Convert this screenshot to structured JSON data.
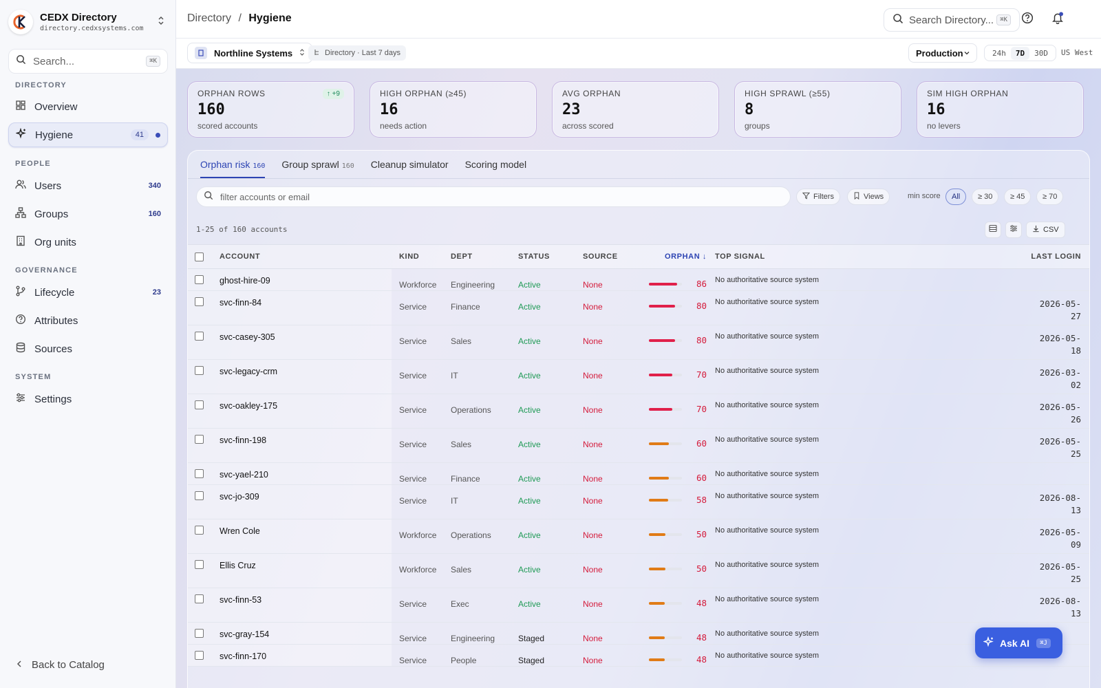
{
  "brand": {
    "name": "CEDX Directory",
    "url": "directory.cedxsystems.com"
  },
  "sidebar": {
    "search_placeholder": "Search...",
    "search_kbd": "⌘K",
    "sections": {
      "directory": "DIRECTORY",
      "people": "PEOPLE",
      "governance": "GOVERNANCE",
      "system": "SYSTEM"
    },
    "items": {
      "overview": {
        "label": "Overview"
      },
      "hygiene": {
        "label": "Hygiene",
        "count": "41"
      },
      "users": {
        "label": "Users",
        "count": "340"
      },
      "groups": {
        "label": "Groups",
        "count": "160"
      },
      "orgunits": {
        "label": "Org units"
      },
      "lifecycle": {
        "label": "Lifecycle",
        "count": "23"
      },
      "attributes": {
        "label": "Attributes"
      },
      "sources": {
        "label": "Sources"
      },
      "settings": {
        "label": "Settings"
      }
    },
    "back": "Back to Catalog"
  },
  "header": {
    "crumb_parent": "Directory",
    "crumb_sep": "/",
    "crumb_current": "Hygiene",
    "search_placeholder": "Search Directory...",
    "search_kbd": "⌘K"
  },
  "subbar": {
    "org": "Northline Systems",
    "scope": "Directory · Last 7 days",
    "env": "Production",
    "ranges": [
      "24h",
      "7D",
      "30D"
    ],
    "region": "US West"
  },
  "kpis": [
    {
      "label": "ORPHAN ROWS",
      "value": "160",
      "sub": "scored accounts",
      "delta": "↑ +9"
    },
    {
      "label": "HIGH ORPHAN (≥45)",
      "value": "16",
      "sub": "needs action"
    },
    {
      "label": "AVG ORPHAN",
      "value": "23",
      "sub": "across scored"
    },
    {
      "label": "HIGH SPRAWL (≥55)",
      "value": "8",
      "sub": "groups"
    },
    {
      "label": "SIM HIGH ORPHAN",
      "value": "16",
      "sub": "no levers"
    }
  ],
  "tabs": [
    {
      "label": "Orphan risk",
      "count": "160"
    },
    {
      "label": "Group sprawl",
      "count": "160"
    },
    {
      "label": "Cleanup simulator"
    },
    {
      "label": "Scoring model"
    }
  ],
  "filter": {
    "placeholder": "filter accounts or email",
    "filters": "Filters",
    "views": "Views",
    "min_score": "min score",
    "scores": [
      "All",
      "≥ 30",
      "≥ 45",
      "≥ 70"
    ]
  },
  "list": {
    "count": "1-25 of 160 accounts",
    "csv": "CSV"
  },
  "columns": {
    "account": "ACCOUNT",
    "kind": "KIND",
    "dept": "DEPT",
    "status": "STATUS",
    "source": "SOURCE",
    "orphan": "ORPHAN ↓",
    "signal": "TOP SIGNAL",
    "login": "LAST LOGIN"
  },
  "rows": [
    {
      "account": "ghost-hire-09",
      "kind": "Workforce",
      "dept": "Engineering",
      "status": "Active",
      "source": "None",
      "score": 86,
      "signal": "No authoritative source system",
      "login": ""
    },
    {
      "account": "svc-finn-84",
      "kind": "Service",
      "dept": "Finance",
      "status": "Active",
      "source": "None",
      "score": 80,
      "signal": "No authoritative source system",
      "login": "2026-05-27"
    },
    {
      "account": "svc-casey-305",
      "kind": "Service",
      "dept": "Sales",
      "status": "Active",
      "source": "None",
      "score": 80,
      "signal": "No authoritative source system",
      "login": "2026-05-18"
    },
    {
      "account": "svc-legacy-crm",
      "kind": "Service",
      "dept": "IT",
      "status": "Active",
      "source": "None",
      "score": 70,
      "signal": "No authoritative source system",
      "login": "2026-03-02"
    },
    {
      "account": "svc-oakley-175",
      "kind": "Service",
      "dept": "Operations",
      "status": "Active",
      "source": "None",
      "score": 70,
      "signal": "No authoritative source system",
      "login": "2026-05-26"
    },
    {
      "account": "svc-finn-198",
      "kind": "Service",
      "dept": "Sales",
      "status": "Active",
      "source": "None",
      "score": 60,
      "signal": "No authoritative source system",
      "login": "2026-05-25"
    },
    {
      "account": "svc-yael-210",
      "kind": "Service",
      "dept": "Finance",
      "status": "Active",
      "source": "None",
      "score": 60,
      "signal": "No authoritative source system",
      "login": ""
    },
    {
      "account": "svc-jo-309",
      "kind": "Service",
      "dept": "IT",
      "status": "Active",
      "source": "None",
      "score": 58,
      "signal": "No authoritative source system",
      "login": "2026-08-13"
    },
    {
      "account": "Wren Cole",
      "kind": "Workforce",
      "dept": "Operations",
      "status": "Active",
      "source": "None",
      "score": 50,
      "signal": "No authoritative source system",
      "login": "2026-05-09"
    },
    {
      "account": "Ellis Cruz",
      "kind": "Workforce",
      "dept": "Sales",
      "status": "Active",
      "source": "None",
      "score": 50,
      "signal": "No authoritative source system",
      "login": "2026-05-25"
    },
    {
      "account": "svc-finn-53",
      "kind": "Service",
      "dept": "Exec",
      "status": "Active",
      "source": "None",
      "score": 48,
      "signal": "No authoritative source system",
      "login": "2026-08-13"
    },
    {
      "account": "svc-gray-154",
      "kind": "Service",
      "dept": "Engineering",
      "status": "Staged",
      "source": "None",
      "score": 48,
      "signal": "No authoritative source system",
      "login": ""
    },
    {
      "account": "svc-finn-170",
      "kind": "Service",
      "dept": "People",
      "status": "Staged",
      "source": "None",
      "score": 48,
      "signal": "No authoritative source system",
      "login": ""
    }
  ],
  "colors": {
    "accent": "#2d44b3",
    "high": "#e0204a",
    "mid": "#e07b16",
    "active": "#1f9a55"
  },
  "askai": {
    "label": "Ask AI",
    "kbd": "⌘J"
  }
}
